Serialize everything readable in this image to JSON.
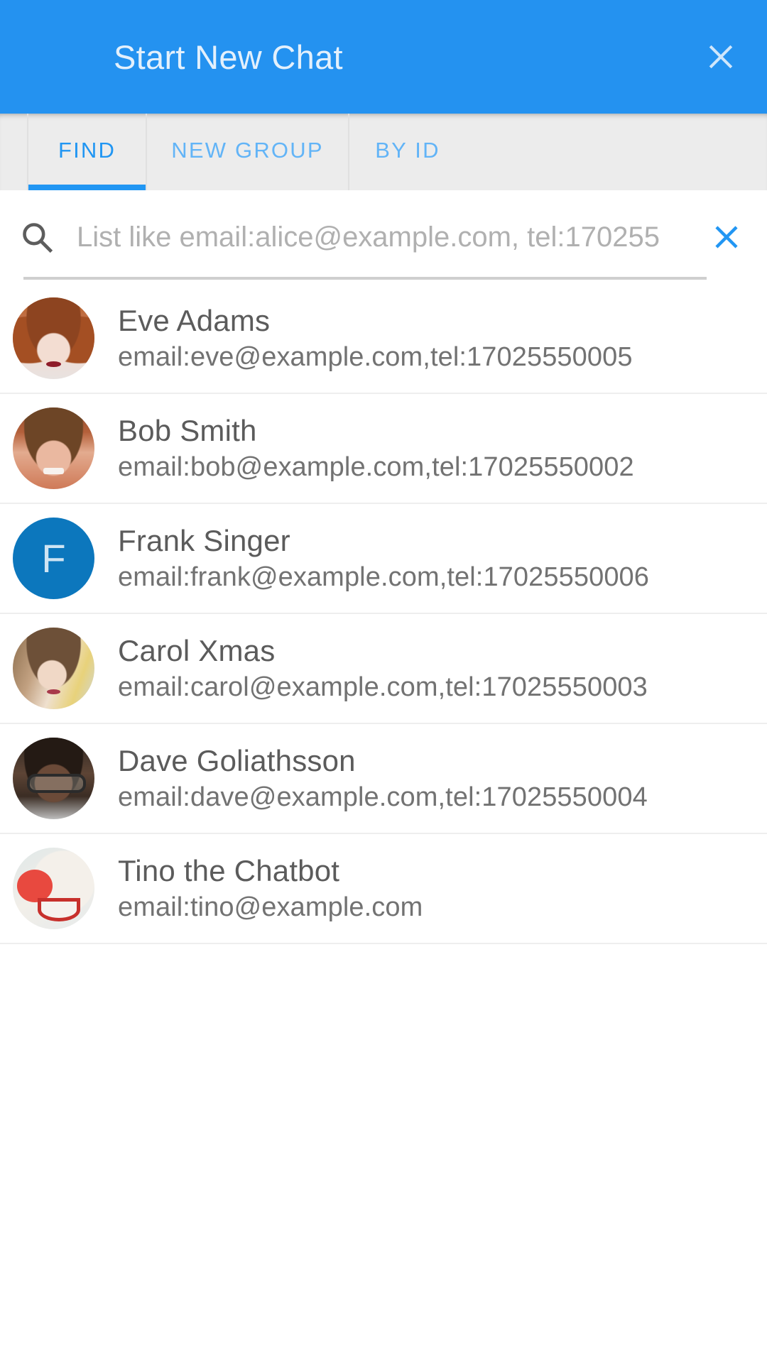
{
  "header": {
    "title": "Start New Chat",
    "close_icon": "close-icon",
    "background_color": "#2492f0",
    "title_color": "#e3f0fc"
  },
  "tabs": {
    "active_index": 0,
    "active_color": "#2196f3",
    "inactive_color": "#62b4f7",
    "items": [
      {
        "label": "FIND"
      },
      {
        "label": "NEW GROUP"
      },
      {
        "label": "BY ID"
      }
    ]
  },
  "search": {
    "icon": "search-icon",
    "placeholder": "List like email:alice@example.com, tel:170255",
    "value": "",
    "clear_icon": "close-icon",
    "clear_color": "#2196f3"
  },
  "contacts": {
    "items": [
      {
        "name": "Eve Adams",
        "detail": "email:eve@example.com,tel:17025550005",
        "avatar_type": "photo",
        "avatar_initial": ""
      },
      {
        "name": "Bob Smith",
        "detail": "email:bob@example.com,tel:17025550002",
        "avatar_type": "photo",
        "avatar_initial": ""
      },
      {
        "name": "Frank Singer",
        "detail": "email:frank@example.com,tel:17025550006",
        "avatar_type": "initial",
        "avatar_initial": "F",
        "avatar_color": "#0c77bd"
      },
      {
        "name": "Carol Xmas",
        "detail": "email:carol@example.com,tel:17025550003",
        "avatar_type": "photo",
        "avatar_initial": ""
      },
      {
        "name": "Dave Goliathsson",
        "detail": "email:dave@example.com,tel:17025550004",
        "avatar_type": "photo",
        "avatar_initial": ""
      },
      {
        "name": "Tino the Chatbot",
        "detail": "email:tino@example.com",
        "avatar_type": "photo",
        "avatar_initial": ""
      }
    ]
  }
}
